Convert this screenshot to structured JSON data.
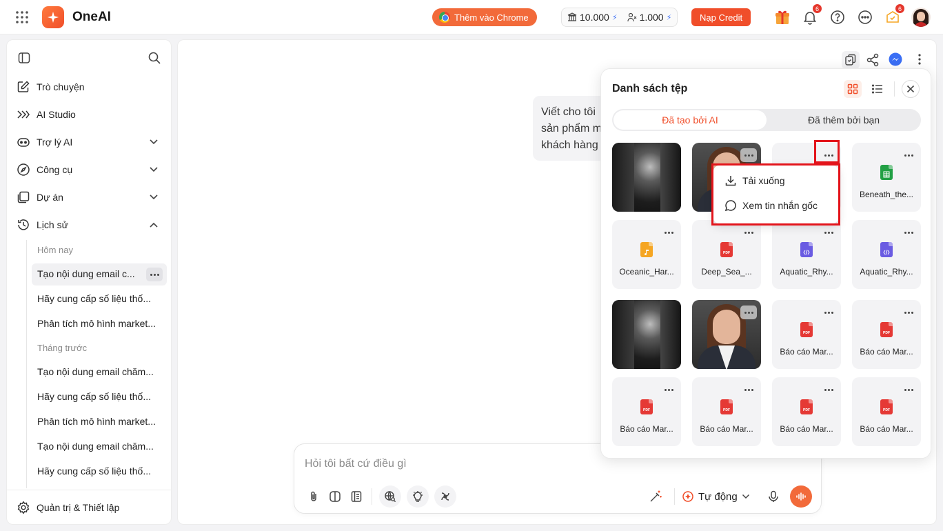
{
  "app": {
    "title": "OneAI"
  },
  "topbar": {
    "chrome_button": "Thêm vào Chrome",
    "credit_1": "10.000",
    "credit_2": "1.000",
    "topup_button": "Nạp Credit",
    "notifications_count": "6",
    "rewards_count": "6"
  },
  "sidebar": {
    "nav": [
      {
        "label": "Trò chuyện"
      },
      {
        "label": "AI Studio"
      },
      {
        "label": "Trợ lý AI"
      },
      {
        "label": "Công cụ"
      },
      {
        "label": "Dự án"
      },
      {
        "label": "Lịch sử"
      }
    ],
    "history": {
      "today_label": "Hôm nay",
      "today": [
        "Tạo nội dung email c...",
        "Hãy cung cấp số liệu thố...",
        "Phân tích mô hình market..."
      ],
      "last_month_label": "Tháng trước",
      "last_month": [
        "Tạo nội dung email chăm...",
        "Hãy cung cấp số liệu thố...",
        "Phân tích mô hình market...",
        "Tạo nội dung email chăm...",
        "Hãy cung cấp số liệu thố..."
      ]
    },
    "settings": "Quản trị & Thiết lập"
  },
  "chat": {
    "message_lines": [
      "Viết cho tôi",
      "sản phẩm m",
      "khách hàng"
    ],
    "input_placeholder": "Hỏi tôi bất cứ điều gì",
    "mode_label": "Tự động"
  },
  "file_panel": {
    "title": "Danh sách tệp",
    "tab_ai": "Đã tạo bởi AI",
    "tab_user": "Đã thêm bởi bạn",
    "files": [
      {
        "name": "Beneath_the...",
        "kind": "sheet"
      },
      {
        "name": "Oceanic_Har...",
        "kind": "audio"
      },
      {
        "name": "Deep_Sea_...",
        "kind": "pdf"
      },
      {
        "name": "Aquatic_Rhy...",
        "kind": "code"
      },
      {
        "name": "Aquatic_Rhy...",
        "kind": "code"
      },
      {
        "name": "Báo cáo Mar...",
        "kind": "pdf"
      },
      {
        "name": "Báo cáo Mar...",
        "kind": "pdf"
      },
      {
        "name": "Báo cáo Mar...",
        "kind": "pdf"
      },
      {
        "name": "Báo cáo Mar...",
        "kind": "pdf"
      },
      {
        "name": "Báo cáo Mar...",
        "kind": "pdf"
      },
      {
        "name": "Báo cáo Mar...",
        "kind": "pdf"
      }
    ],
    "pdf_tag": "PDF",
    "context_menu": {
      "download": "Tải xuống",
      "view_original": "Xem tin nhắn gốc"
    }
  },
  "colors": {
    "accent": "#f04e2a",
    "highlight_frame": "#e3141b",
    "pdf": "#e53935",
    "sheet": "#22a045",
    "audio": "#f5a623",
    "code": "#6a5be2"
  }
}
